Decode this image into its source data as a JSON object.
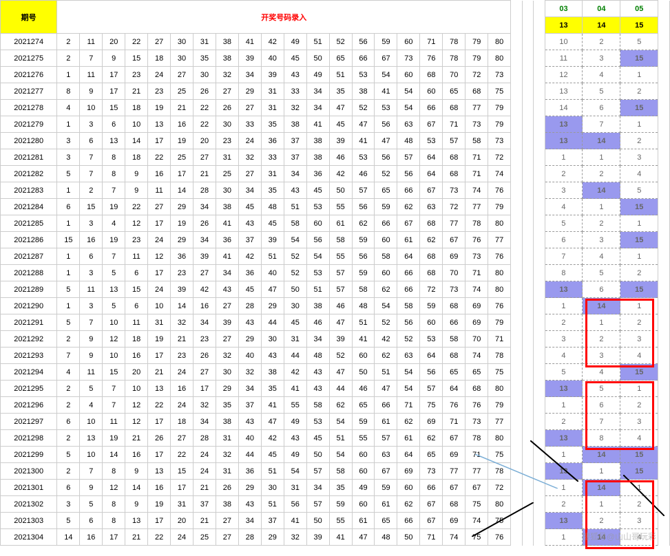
{
  "header": {
    "period_label": "期号",
    "title": "开奖号码录入",
    "stat_top": [
      "03",
      "04",
      "05"
    ],
    "stat_sub": [
      "13",
      "14",
      "15"
    ]
  },
  "rows": [
    {
      "p": "2021274",
      "n": [
        2,
        11,
        20,
        22,
        27,
        30,
        31,
        38,
        41,
        42,
        49,
        51,
        52,
        56,
        59,
        60,
        71,
        78,
        79,
        80
      ],
      "s": [
        {
          "v": 10
        },
        {
          "v": 2
        },
        {
          "v": 5
        }
      ]
    },
    {
      "p": "2021275",
      "n": [
        2,
        7,
        9,
        15,
        18,
        30,
        35,
        38,
        39,
        40,
        45,
        50,
        65,
        66,
        67,
        73,
        76,
        78,
        79,
        80
      ],
      "s": [
        {
          "v": 11
        },
        {
          "v": 3
        },
        {
          "v": 15,
          "h": 1
        }
      ]
    },
    {
      "p": "2021276",
      "n": [
        1,
        11,
        17,
        23,
        24,
        27,
        30,
        32,
        34,
        39,
        43,
        49,
        51,
        53,
        54,
        60,
        68,
        70,
        72,
        73
      ],
      "s": [
        {
          "v": 12
        },
        {
          "v": 4
        },
        {
          "v": 1
        }
      ]
    },
    {
      "p": "2021277",
      "n": [
        8,
        9,
        17,
        21,
        23,
        25,
        26,
        27,
        29,
        31,
        33,
        34,
        35,
        38,
        41,
        54,
        60,
        65,
        68,
        75
      ],
      "s": [
        {
          "v": 13
        },
        {
          "v": 5
        },
        {
          "v": 2
        }
      ]
    },
    {
      "p": "2021278",
      "n": [
        4,
        10,
        15,
        18,
        19,
        21,
        22,
        26,
        27,
        31,
        32,
        34,
        47,
        52,
        53,
        54,
        66,
        68,
        77,
        79
      ],
      "s": [
        {
          "v": 14
        },
        {
          "v": 6
        },
        {
          "v": 15,
          "h": 1
        }
      ]
    },
    {
      "p": "2021279",
      "n": [
        1,
        3,
        6,
        10,
        13,
        16,
        22,
        30,
        33,
        35,
        38,
        41,
        45,
        47,
        56,
        63,
        67,
        71,
        73,
        79
      ],
      "s": [
        {
          "v": 13,
          "h": 1
        },
        {
          "v": 7
        },
        {
          "v": 1
        }
      ]
    },
    {
      "p": "2021280",
      "n": [
        3,
        6,
        13,
        14,
        17,
        19,
        20,
        23,
        24,
        36,
        37,
        38,
        39,
        41,
        47,
        48,
        53,
        57,
        58,
        73
      ],
      "s": [
        {
          "v": 13,
          "h": 1
        },
        {
          "v": 14,
          "h": 1
        },
        {
          "v": 2
        }
      ]
    },
    {
      "p": "2021281",
      "n": [
        3,
        7,
        8,
        18,
        22,
        25,
        27,
        31,
        32,
        33,
        37,
        38,
        46,
        53,
        56,
        57,
        64,
        68,
        71,
        72
      ],
      "s": [
        {
          "v": 1
        },
        {
          "v": 1
        },
        {
          "v": 3
        }
      ]
    },
    {
      "p": "2021282",
      "n": [
        5,
        7,
        8,
        9,
        16,
        17,
        21,
        25,
        27,
        31,
        34,
        36,
        42,
        46,
        52,
        56,
        64,
        68,
        71,
        74
      ],
      "s": [
        {
          "v": 2
        },
        {
          "v": 2
        },
        {
          "v": 4
        }
      ]
    },
    {
      "p": "2021283",
      "n": [
        1,
        2,
        7,
        9,
        11,
        14,
        28,
        30,
        34,
        35,
        43,
        45,
        50,
        57,
        65,
        66,
        67,
        73,
        74,
        76
      ],
      "s": [
        {
          "v": 3
        },
        {
          "v": 14,
          "h": 1
        },
        {
          "v": 5
        }
      ]
    },
    {
      "p": "2021284",
      "n": [
        6,
        15,
        19,
        22,
        27,
        29,
        34,
        38,
        45,
        48,
        51,
        53,
        55,
        56,
        59,
        62,
        63,
        72,
        77,
        79
      ],
      "s": [
        {
          "v": 4
        },
        {
          "v": 1
        },
        {
          "v": 15,
          "h": 1
        }
      ]
    },
    {
      "p": "2021285",
      "n": [
        1,
        3,
        4,
        12,
        17,
        19,
        26,
        41,
        43,
        45,
        58,
        60,
        61,
        62,
        66,
        67,
        68,
        77,
        78,
        80
      ],
      "s": [
        {
          "v": 5
        },
        {
          "v": 2
        },
        {
          "v": 1
        }
      ]
    },
    {
      "p": "2021286",
      "n": [
        15,
        16,
        19,
        23,
        24,
        29,
        34,
        36,
        37,
        39,
        54,
        56,
        58,
        59,
        60,
        61,
        62,
        67,
        76,
        77
      ],
      "s": [
        {
          "v": 6
        },
        {
          "v": 3
        },
        {
          "v": 15,
          "h": 1
        }
      ]
    },
    {
      "p": "2021287",
      "n": [
        1,
        6,
        7,
        11,
        12,
        36,
        39,
        41,
        42,
        51,
        52,
        54,
        55,
        56,
        58,
        64,
        68,
        69,
        73,
        76
      ],
      "s": [
        {
          "v": 7
        },
        {
          "v": 4
        },
        {
          "v": 1
        }
      ]
    },
    {
      "p": "2021288",
      "n": [
        1,
        3,
        5,
        6,
        17,
        23,
        27,
        34,
        36,
        40,
        52,
        53,
        57,
        59,
        60,
        66,
        68,
        70,
        71,
        80
      ],
      "s": [
        {
          "v": 8
        },
        {
          "v": 5
        },
        {
          "v": 2
        }
      ]
    },
    {
      "p": "2021289",
      "n": [
        5,
        11,
        13,
        15,
        24,
        39,
        42,
        43,
        45,
        47,
        50,
        51,
        57,
        58,
        62,
        66,
        72,
        73,
        74,
        80
      ],
      "s": [
        {
          "v": 13,
          "h": 1
        },
        {
          "v": 6
        },
        {
          "v": 15,
          "h": 1
        }
      ]
    },
    {
      "p": "2021290",
      "n": [
        1,
        3,
        5,
        6,
        10,
        14,
        16,
        27,
        28,
        29,
        30,
        38,
        46,
        48,
        54,
        58,
        59,
        68,
        69,
        76
      ],
      "s": [
        {
          "v": 1
        },
        {
          "v": 14,
          "h": 1
        },
        {
          "v": 1
        }
      ]
    },
    {
      "p": "2021291",
      "n": [
        5,
        7,
        10,
        11,
        31,
        32,
        34,
        39,
        43,
        44,
        45,
        46,
        47,
        51,
        52,
        56,
        60,
        66,
        69,
        79
      ],
      "s": [
        {
          "v": 2
        },
        {
          "v": 1
        },
        {
          "v": 2
        }
      ]
    },
    {
      "p": "2021292",
      "n": [
        2,
        9,
        12,
        18,
        19,
        21,
        23,
        27,
        29,
        30,
        31,
        34,
        39,
        41,
        42,
        52,
        53,
        58,
        70,
        71
      ],
      "s": [
        {
          "v": 3
        },
        {
          "v": 2
        },
        {
          "v": 3
        }
      ]
    },
    {
      "p": "2021293",
      "n": [
        7,
        9,
        10,
        16,
        17,
        23,
        26,
        32,
        40,
        43,
        44,
        48,
        52,
        60,
        62,
        63,
        64,
        68,
        74,
        78
      ],
      "s": [
        {
          "v": 4
        },
        {
          "v": 3
        },
        {
          "v": 4
        }
      ]
    },
    {
      "p": "2021294",
      "n": [
        4,
        11,
        15,
        20,
        21,
        24,
        27,
        30,
        32,
        38,
        42,
        43,
        47,
        50,
        51,
        54,
        56,
        65,
        65,
        75
      ],
      "s": [
        {
          "v": 5
        },
        {
          "v": 4
        },
        {
          "v": 15,
          "h": 1
        }
      ]
    },
    {
      "p": "2021295",
      "n": [
        2,
        5,
        7,
        10,
        13,
        16,
        17,
        29,
        34,
        35,
        41,
        43,
        44,
        46,
        47,
        54,
        57,
        64,
        68,
        80
      ],
      "s": [
        {
          "v": 13,
          "h": 1
        },
        {
          "v": 5
        },
        {
          "v": 1
        }
      ]
    },
    {
      "p": "2021296",
      "n": [
        2,
        4,
        7,
        12,
        22,
        24,
        32,
        35,
        37,
        41,
        55,
        58,
        62,
        65,
        66,
        71,
        75,
        76,
        76,
        79
      ],
      "s": [
        {
          "v": 1
        },
        {
          "v": 6
        },
        {
          "v": 2
        }
      ]
    },
    {
      "p": "2021297",
      "n": [
        6,
        10,
        11,
        12,
        17,
        18,
        34,
        38,
        43,
        47,
        49,
        53,
        54,
        59,
        61,
        62,
        69,
        71,
        73,
        77
      ],
      "s": [
        {
          "v": 2
        },
        {
          "v": 7
        },
        {
          "v": 3
        }
      ]
    },
    {
      "p": "2021298",
      "n": [
        2,
        13,
        19,
        21,
        26,
        27,
        28,
        31,
        40,
        42,
        43,
        45,
        51,
        55,
        57,
        61,
        62,
        67,
        78,
        80
      ],
      "s": [
        {
          "v": 13,
          "h": 1
        },
        {
          "v": 8
        },
        {
          "v": 4
        }
      ]
    },
    {
      "p": "2021299",
      "n": [
        5,
        10,
        14,
        16,
        17,
        22,
        24,
        32,
        44,
        45,
        49,
        50,
        54,
        60,
        63,
        64,
        65,
        69,
        71,
        75
      ],
      "s": [
        {
          "v": 1
        },
        {
          "v": 14,
          "h": 1
        },
        {
          "v": 15,
          "h": 1
        }
      ]
    },
    {
      "p": "2021300",
      "n": [
        2,
        7,
        8,
        9,
        13,
        15,
        24,
        31,
        36,
        51,
        54,
        57,
        58,
        60,
        67,
        69,
        73,
        77,
        77,
        78
      ],
      "s": [
        {
          "v": 13,
          "h": 1
        },
        {
          "v": 1
        },
        {
          "v": 15,
          "h": 1
        }
      ]
    },
    {
      "p": "2021301",
      "n": [
        6,
        9,
        12,
        14,
        16,
        17,
        21,
        26,
        29,
        30,
        31,
        34,
        35,
        49,
        59,
        60,
        66,
        67,
        67,
        72
      ],
      "s": [
        {
          "v": 1
        },
        {
          "v": 14,
          "h": 1
        },
        {
          "v": 1
        }
      ]
    },
    {
      "p": "2021302",
      "n": [
        3,
        5,
        8,
        9,
        19,
        31,
        37,
        38,
        43,
        51,
        56,
        57,
        59,
        60,
        61,
        62,
        67,
        68,
        75,
        80
      ],
      "s": [
        {
          "v": 2
        },
        {
          "v": 1
        },
        {
          "v": 2
        }
      ]
    },
    {
      "p": "2021303",
      "n": [
        5,
        6,
        8,
        13,
        17,
        20,
        21,
        27,
        34,
        37,
        41,
        50,
        55,
        61,
        65,
        66,
        67,
        69,
        74,
        75
      ],
      "s": [
        {
          "v": 13,
          "h": 1
        },
        {
          "v": 2
        },
        {
          "v": 3
        }
      ]
    },
    {
      "p": "2021304",
      "n": [
        14,
        16,
        17,
        21,
        22,
        24,
        25,
        27,
        28,
        29,
        32,
        39,
        41,
        47,
        48,
        50,
        71,
        74,
        75,
        76
      ],
      "s": [
        {
          "v": 1
        },
        {
          "v": 14,
          "h": 1
        },
        {
          "v": 4
        }
      ]
    }
  ],
  "watermark": "搜狐号@山山哥玩彩"
}
